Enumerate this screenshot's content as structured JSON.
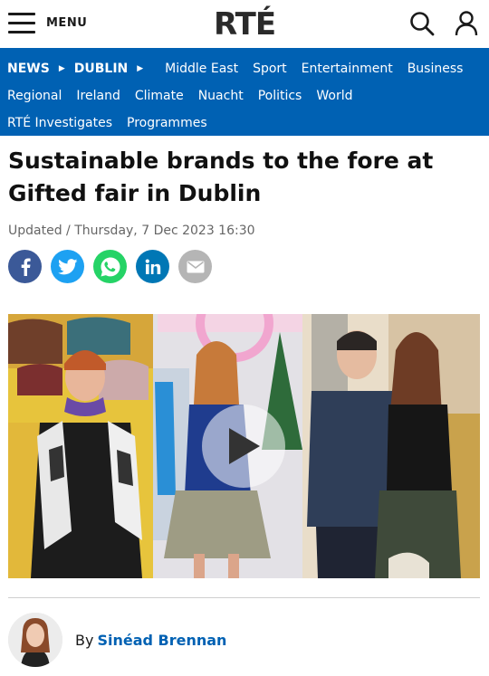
{
  "header": {
    "menu_label": "MENU",
    "logo": "RTÉ"
  },
  "nav": {
    "breadcrumb": [
      "NEWS",
      "DUBLIN"
    ],
    "row1": [
      "Middle East",
      "Sport",
      "Entertainment",
      "Business"
    ],
    "row2": [
      "Regional",
      "Ireland",
      "Climate",
      "Nuacht",
      "Politics",
      "World"
    ],
    "row3": [
      "RTÉ Investigates",
      "Programmes"
    ]
  },
  "article": {
    "headline": "Sustainable brands to the fore at Gifted fair in Dublin",
    "updated": "Updated / Thursday, 7 Dec 2023 16:30",
    "byline_prefix": "By",
    "author_name": "Sinéad Brennan"
  },
  "share": [
    {
      "icon": "facebook-icon",
      "color": "#3b5998"
    },
    {
      "icon": "twitter-icon",
      "color": "#1da1f2"
    },
    {
      "icon": "whatsapp-icon",
      "color": "#25d366"
    },
    {
      "icon": "linkedin-icon",
      "color": "#0077b5"
    },
    {
      "icon": "email-icon",
      "color": "#b5b5b5"
    }
  ],
  "colors": {
    "brand_blue": "#0061b3",
    "headline": "#111111"
  }
}
